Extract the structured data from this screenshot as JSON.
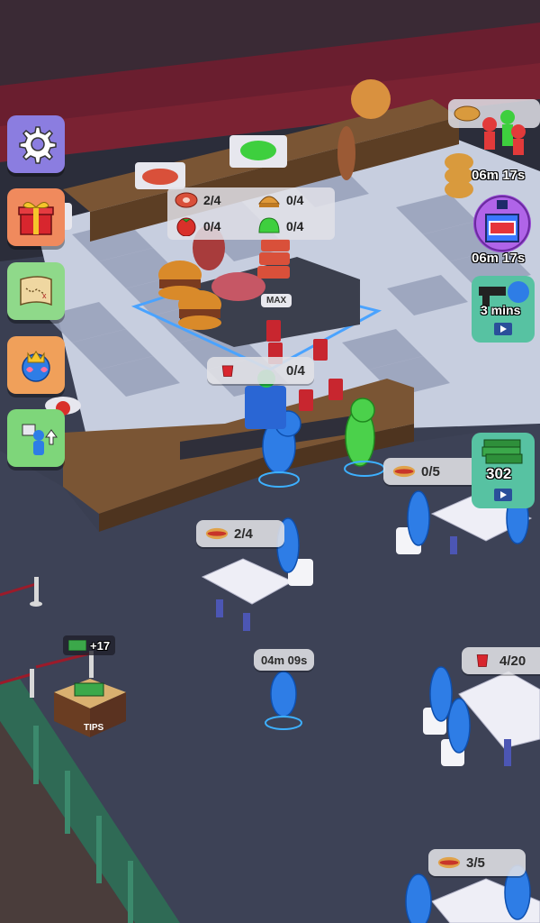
{
  "ingredients": [
    {
      "icon": "meat-icon",
      "count": "2/4"
    },
    {
      "icon": "bun-icon",
      "count": "0/4"
    },
    {
      "icon": "tomato-icon",
      "count": "0/4"
    },
    {
      "icon": "lettuce-icon",
      "count": "0/4"
    }
  ],
  "max_label": "MAX",
  "counter_drink": "0/4",
  "orders": {
    "table_top": "0/5",
    "table_left": "2/4",
    "table_right": "4/20",
    "table_bottom": "3/5"
  },
  "timers": {
    "helpers": "06m 17s",
    "potion": "06m 17s",
    "gun": "3 mins",
    "customer_wait": "04m 09s"
  },
  "money": {
    "reward_amount": "302",
    "tips_bonus": "+17",
    "tips_label": "TIPS"
  },
  "colors": {
    "settings_bg": "#8b7de0",
    "gift_bg": "#f08a5d",
    "map_bg": "#8fd98a",
    "skin_bg": "#f0a05a",
    "upgrade_bg": "#7ed67a",
    "floor_light": "#dde2ee",
    "floor_dark": "#a9b2c9",
    "carpet": "#3d4256"
  }
}
